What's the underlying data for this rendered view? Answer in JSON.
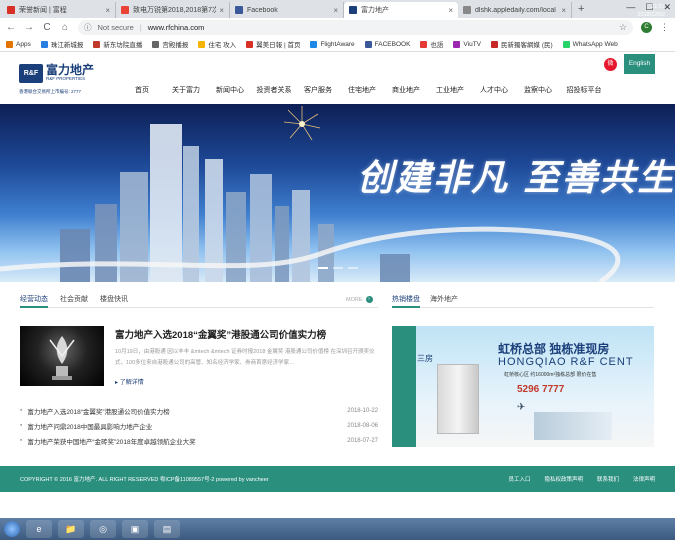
{
  "browser": {
    "tabs": [
      {
        "title": "荣誉新闻 | 富程",
        "color": "#d93025",
        "active": false
      },
      {
        "title": "致电万锐第2018,2018第7次",
        "color": "#ea4335",
        "active": false
      },
      {
        "title": "Facebook",
        "color": "#3b5998",
        "active": false
      },
      {
        "title": "富力地产",
        "color": "#1b3f7a",
        "active": true
      },
      {
        "title": "dlshk.appledaily.com/local",
        "color": "#888888",
        "active": false
      }
    ],
    "new_tab_symbol": "+",
    "address": {
      "secure_label": "Not secure",
      "url": "www.rfchina.com"
    },
    "profile_initial": "C",
    "bookmarks": [
      {
        "label": "Apps",
        "color": "#e37400"
      },
      {
        "label": "珠江新城报",
        "color": "#2a7de1"
      },
      {
        "label": "新东坊院直播",
        "color": "#c0392b"
      },
      {
        "label": "宫殿播报",
        "color": "#666666"
      },
      {
        "label": "住宅 攻入",
        "color": "#f4b400"
      },
      {
        "label": "翼美日報 | 首页",
        "color": "#d93025"
      },
      {
        "label": "FlightAware",
        "color": "#1e88e5"
      },
      {
        "label": "FACEBOOK",
        "color": "#3b5998"
      },
      {
        "label": "也語",
        "color": "#e53935"
      },
      {
        "label": "ViuTV",
        "color": "#9c27b0"
      },
      {
        "label": "民新獨客網媒 (民)",
        "color": "#c62828"
      },
      {
        "label": "WhatsApp Web",
        "color": "#25d366"
      }
    ]
  },
  "site": {
    "logo_mark": "R&F",
    "logo_cn": "富力地产",
    "logo_en": "R&F PROPERTIES",
    "logo_sub": "香港联合交易所上市编号: 2777",
    "lang_button": "English",
    "weibo_icon": "微",
    "nav": [
      "首页",
      "关于富力",
      "新闻中心",
      "投资者关系",
      "客户服务",
      "住宅地产",
      "商业地产",
      "工业地产",
      "人才中心",
      "监察中心",
      "招投标平台"
    ],
    "banner_slogan": "创建非凡 至善共生"
  },
  "news": {
    "tabs": [
      "经营动态",
      "社会贡献",
      "楼盘快讯"
    ],
    "active_tab": 0,
    "more_label": "MORE",
    "featured": {
      "title": "富力地产入选2018“金翼奖”港股通公司价值实力榜",
      "desc": "10月19日，由港股通 因以丰丰 &mtech &mtech 证券时报2018 金翼奖 港股通公司价值榜 在深圳召开颁奖仪式，100多位来自港股通公司的高管、知名经济学家、券商首席经济学家…",
      "more": "了解详情"
    },
    "items": [
      {
        "title": "富力地产入选2018“金翼奖”港股通公司价值实力榜",
        "date": "2018-10-22"
      },
      {
        "title": "富力地产问鼎2018中国最具影响力地产企业",
        "date": "2018-08-06"
      },
      {
        "title": "富力地产荣获中国地产“金砖奖”2018年度卓越领航企业大奖",
        "date": "2018-07-27"
      }
    ]
  },
  "property": {
    "tabs": [
      "热销楼盘",
      "海外地产"
    ],
    "active_tab": 0,
    "ad": {
      "headline": "虹桥总部 独栋准现房",
      "headline_en": "HONGQIAO R&F CENT",
      "sub": "虹桥核心区 约16000m²独栋总部 限价在售",
      "phone": "5296 7777",
      "badge": "三房"
    }
  },
  "footer": {
    "copyright": "COPYRIGHT © 2016 富力地产. ALL RIGHT RESERVED 粤ICP备11089557号-2 powered by vancheer",
    "links": [
      "员工入口",
      "隐私权政策声明",
      "联系我们",
      "法律声明"
    ]
  },
  "taskbar": {
    "apps": [
      "e",
      "📁",
      "◎",
      "▣",
      "▤"
    ],
    "time": "21:57",
    "date": "2018/12/02"
  }
}
